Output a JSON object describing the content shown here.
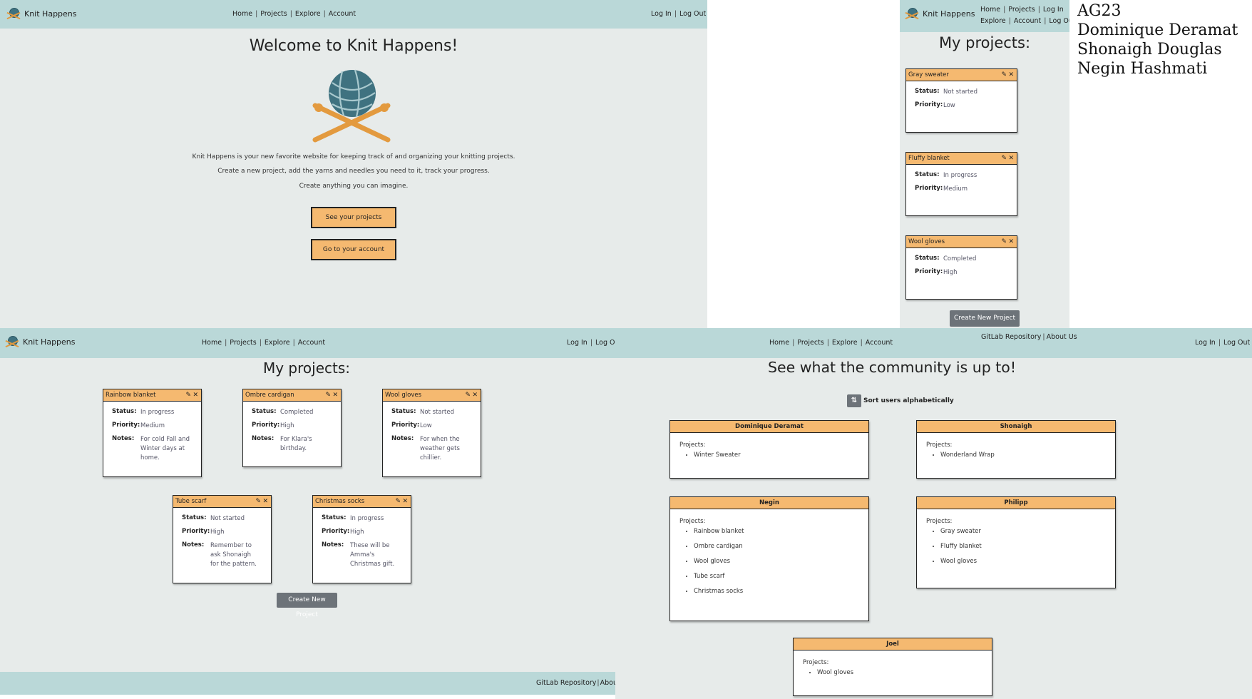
{
  "brand": "Knit Happens",
  "nav": {
    "home": "Home",
    "projects": "Projects",
    "explore": "Explore",
    "account": "Account",
    "login": "Log In",
    "logout": "Log Out",
    "sep": "|"
  },
  "footer": {
    "repo": "GitLab Repository",
    "about": "About Us"
  },
  "home": {
    "title": "Welcome to Knit Happens!",
    "line1": "Knit Happens is your new favorite website for keeping track of and organizing your knitting projects.",
    "line2": "Create a new project, add the yarns and needles you need to it, track your progress.",
    "line3": "Create anything you can imagine.",
    "btn_projects": "See your projects",
    "btn_account": "Go to your account"
  },
  "labels": {
    "status": "Status:",
    "priority": "Priority:",
    "notes": "Notes:",
    "projects": "Projects:",
    "edit_icon": "pencil-icon",
    "close_icon": "x-icon"
  },
  "mobile": {
    "title": "My projects:",
    "cards": [
      {
        "name": "Gray sweater",
        "status": "Not started",
        "priority": "Low"
      },
      {
        "name": "Fluffy blanket",
        "status": "In progress",
        "priority": "Medium"
      },
      {
        "name": "Wool gloves",
        "status": "Completed",
        "priority": "High"
      }
    ],
    "create": "Create New Project"
  },
  "credits": [
    "AG23",
    "Dominique Deramat",
    "Shonaigh Douglas",
    "Negin Hashmati"
  ],
  "projects_page": {
    "title": "My projects:",
    "cards": [
      {
        "name": "Rainbow blanket",
        "status": "In progress",
        "priority": "Medium",
        "notes": "For cold Fall and Winter days at home."
      },
      {
        "name": "Ombre cardigan",
        "status": "Completed",
        "priority": "High",
        "notes": "For Klara's birthday."
      },
      {
        "name": "Wool gloves",
        "status": "Not started",
        "priority": "Low",
        "notes": "For when the weather gets chillier."
      },
      {
        "name": "Tube scarf",
        "status": "Not started",
        "priority": "High",
        "notes": "Remember to ask Shonaigh for the pattern."
      },
      {
        "name": "Christmas socks",
        "status": "In progress",
        "priority": "High",
        "notes": "These will be Amma's Christmas gift."
      }
    ],
    "create": "Create New Project"
  },
  "explore": {
    "title": "See what the community is up to!",
    "sort": "Sort users alphabetically",
    "users": [
      {
        "name": "Dominique Deramat",
        "projects": [
          "Winter Sweater"
        ]
      },
      {
        "name": "Shonaigh",
        "projects": [
          "Wonderland Wrap"
        ]
      },
      {
        "name": "Negin",
        "projects": [
          "Rainbow blanket",
          "Ombre cardigan",
          "Wool gloves",
          "Tube scarf",
          "Christmas socks"
        ]
      },
      {
        "name": "Philipp",
        "projects": [
          "Gray sweater",
          "Fluffy blanket",
          "Wool gloves"
        ]
      },
      {
        "name": "Joel",
        "projects": [
          "Wool gloves"
        ]
      }
    ]
  }
}
